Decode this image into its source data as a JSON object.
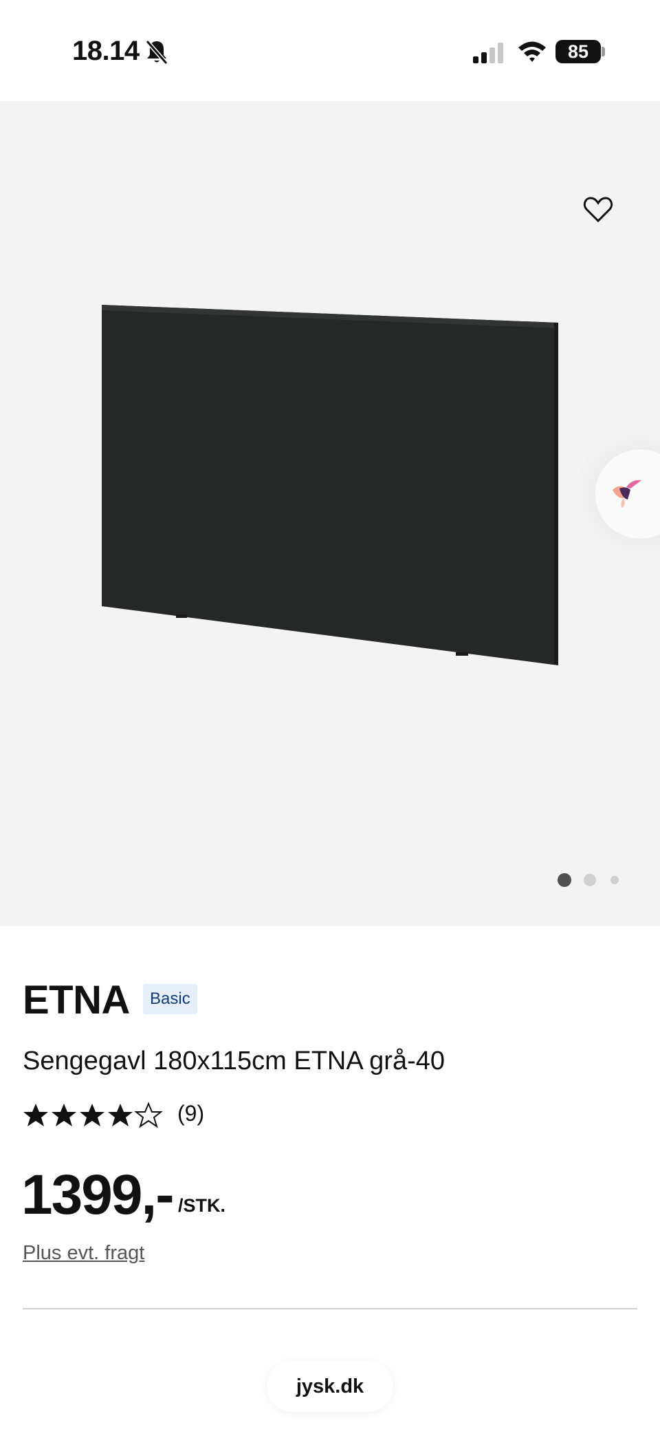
{
  "status_bar": {
    "time": "18.14",
    "battery": "85",
    "icons": [
      "bell-slash-icon",
      "cellular-signal-icon",
      "wifi-icon",
      "battery-icon"
    ]
  },
  "gallery": {
    "background_color": "#f3f3f3",
    "favorite_icon": "heart-outline-icon",
    "chat_icon": "hummingbird-chat-icon",
    "slide_count": 3,
    "active_slide": 1
  },
  "product": {
    "brand": "ETNA",
    "badge": "Basic",
    "subtitle": "Sengegavl 180x115cm ETNA grå-40",
    "rating": 4,
    "rating_max": 5,
    "review_count": "(9)",
    "price": "1399,-",
    "unit": "/STK.",
    "shipping_link": "Plus evt. fragt"
  },
  "browser": {
    "url": "jysk.dk"
  },
  "colors": {
    "badge_bg": "#e6eefa",
    "badge_text": "#143c78",
    "headboard": "#262727"
  }
}
